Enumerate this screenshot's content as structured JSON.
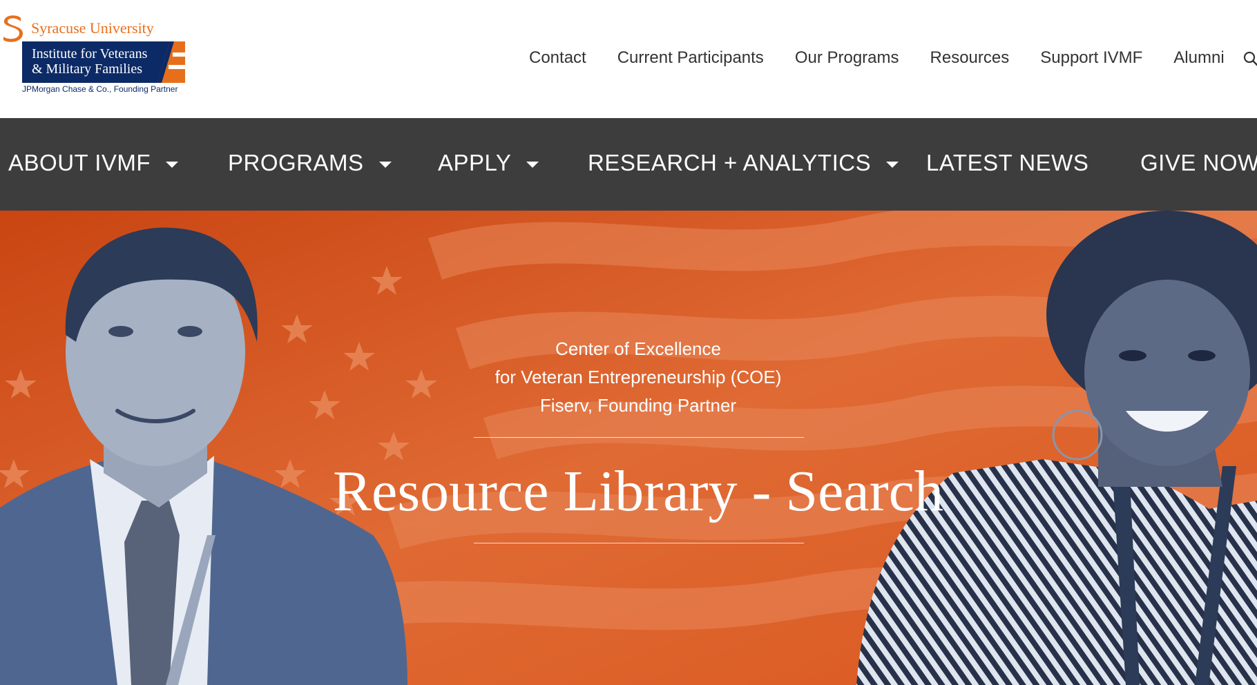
{
  "header": {
    "logo": {
      "university": "Syracuse University",
      "institute_line1": "Institute for Veterans",
      "institute_line2": "& Military Families",
      "partner": "JPMorgan Chase & Co., Founding Partner"
    },
    "top_nav": [
      {
        "label": "Contact"
      },
      {
        "label": "Current Participants"
      },
      {
        "label": "Our Programs"
      },
      {
        "label": "Resources"
      },
      {
        "label": "Support IVMF"
      },
      {
        "label": "Alumni"
      }
    ],
    "search_icon": "search-icon"
  },
  "main_nav": [
    {
      "label": "ABOUT IVMF",
      "has_dropdown": true
    },
    {
      "label": "PROGRAMS",
      "has_dropdown": true
    },
    {
      "label": "APPLY",
      "has_dropdown": true
    },
    {
      "label": "RESEARCH + ANALYTICS",
      "has_dropdown": true
    },
    {
      "label": "LATEST NEWS",
      "has_dropdown": false
    },
    {
      "label": "GIVE NOW",
      "has_dropdown": false
    }
  ],
  "hero": {
    "subtitle_line1": "Center of Excellence",
    "subtitle_line2": "for Veteran Entrepreneurship (COE)",
    "subtitle_line3": "Fiserv, Founding Partner",
    "title": "Resource Library - Search"
  },
  "colors": {
    "nav_bg": "#3d3d3e",
    "hero_orange": "#d3521c",
    "syracuse_orange": "#e76f1c",
    "navy": "#0c2a66"
  }
}
